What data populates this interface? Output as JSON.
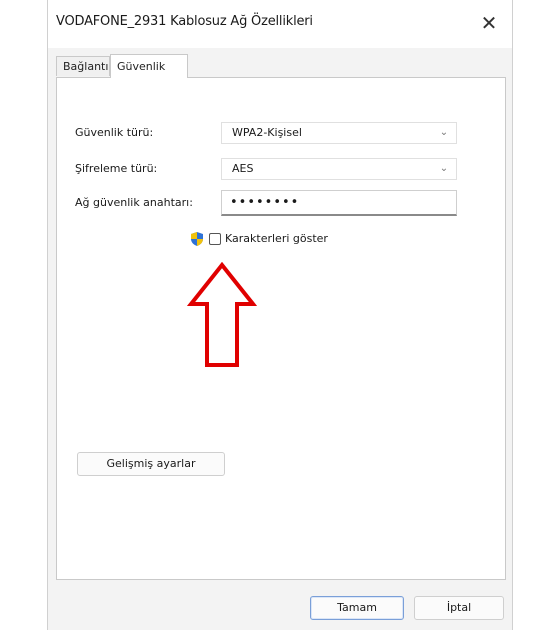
{
  "window": {
    "title": "VODAFONE_2931 Kablosuz Ağ Özellikleri",
    "close_glyph": "✕"
  },
  "tabs": [
    {
      "label": "Bağlantı"
    },
    {
      "label": "Güvenlik"
    }
  ],
  "security": {
    "type_label": "Güvenlik türü:",
    "type_value": "WPA2-Kişisel",
    "encryption_label": "Şifreleme türü:",
    "encryption_value": "AES",
    "key_label": "Ağ güvenlik anahtarı:",
    "key_value": "••••••••",
    "show_chars_label": "Karakterleri göster",
    "show_chars_checked": false
  },
  "buttons": {
    "advanced": "Gelişmiş ayarlar",
    "ok": "Tamam",
    "cancel": "İptal"
  },
  "colors": {
    "arrow": "#e00000",
    "dialog_bg": "#f3f3f3",
    "ok_border": "#7a9fd8"
  },
  "icons": {
    "chevron": "chevron-down-icon",
    "shield": "uac-shield-icon",
    "close": "close-icon"
  }
}
